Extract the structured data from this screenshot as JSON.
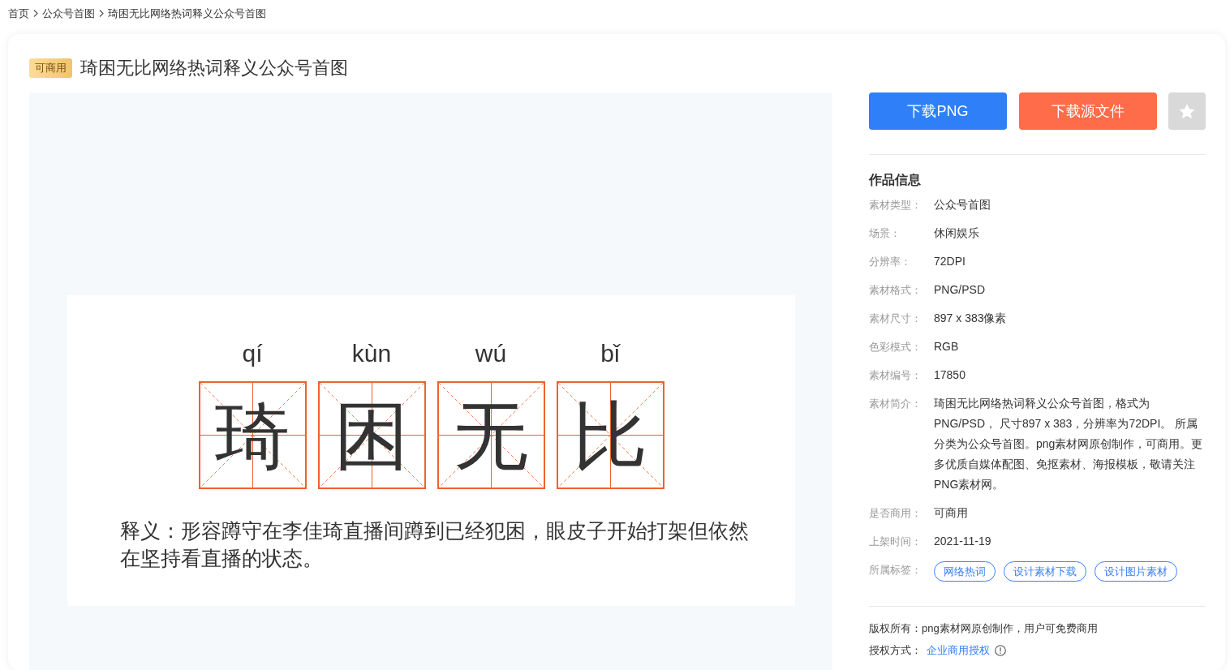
{
  "breadcrumb": [
    "首页",
    "公众号首图",
    "琦困无比网络热词释义公众号首图"
  ],
  "header": {
    "badge": "可商用",
    "title": "琦困无比网络热词释义公众号首图"
  },
  "preview": {
    "characters": [
      {
        "pinyin": "qí",
        "hanzi": "琦"
      },
      {
        "pinyin": "kùn",
        "hanzi": "困"
      },
      {
        "pinyin": "wú",
        "hanzi": "无"
      },
      {
        "pinyin": "bǐ",
        "hanzi": "比"
      }
    ],
    "definition": "释义：形容蹲守在李佳琦直播间蹲到已经犯困，眼皮子开始打架但依然在坚持看直播的状态。"
  },
  "actions": {
    "download_png": "下载PNG",
    "download_source": "下载源文件"
  },
  "info": {
    "heading": "作品信息",
    "rows": [
      {
        "kind": "text",
        "label": "素材类型：",
        "value": "公众号首图"
      },
      {
        "kind": "text",
        "label": "场景：",
        "value": "休闲娱乐"
      },
      {
        "kind": "text",
        "label": "分辨率：",
        "value": "72DPI"
      },
      {
        "kind": "text",
        "label": "素材格式：",
        "value": "PNG/PSD"
      },
      {
        "kind": "text",
        "label": "素材尺寸：",
        "value": "897 x 383像素"
      },
      {
        "kind": "text",
        "label": "色彩模式：",
        "value": "RGB"
      },
      {
        "kind": "text",
        "label": "素材编号：",
        "value": "17850"
      },
      {
        "kind": "text",
        "label": "素材简介：",
        "value": "琦困无比网络热词释义公众号首图，格式为PNG/PSD， 尺寸897 x 383，分辨率为72DPI。 所属分类为公众号首图。png素材网原创制作，可商用。更多优质自媒体配图、免抠素材、海报模板，敬请关注PNG素材网。"
      },
      {
        "kind": "text",
        "label": "是否商用：",
        "value": "可商用"
      },
      {
        "kind": "text",
        "label": "上架时间：",
        "value": "2021-11-19"
      },
      {
        "kind": "tags",
        "label": "所属标签：",
        "tags": [
          "网络热词",
          "设计素材下载",
          "设计图片素材"
        ]
      }
    ]
  },
  "footer": {
    "copyright": "版权所有：png素材网原创制作，用户可免费商用",
    "license_label": "授权方式：",
    "license_link": "企业商用授权"
  }
}
